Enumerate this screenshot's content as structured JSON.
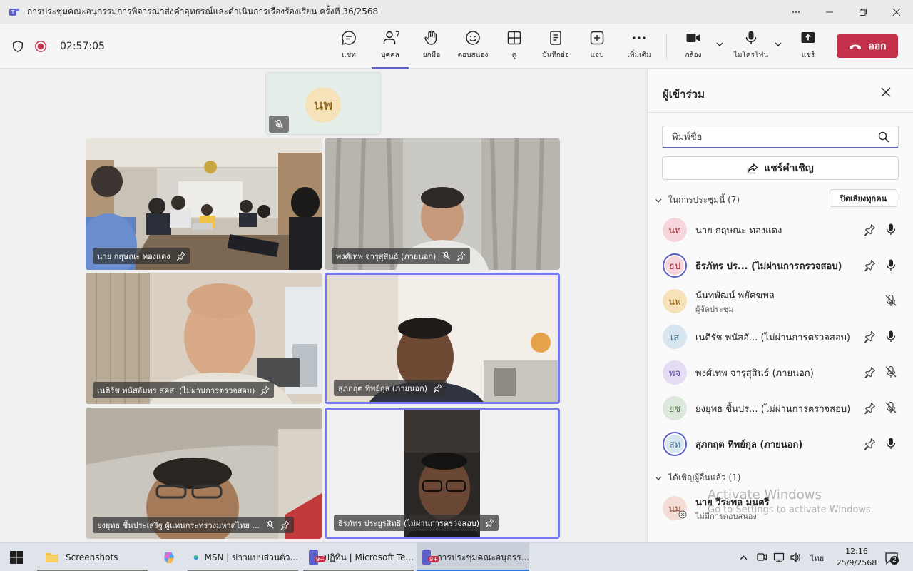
{
  "window": {
    "title": "การประชุมคณะอนุกรรมการพิจารณาส่งคำอุทธรณ์และดำเนินการเรื่องร้องเรียน ครั้งที่ 36/2568"
  },
  "toolbar": {
    "timer": "02:57:05",
    "chat": "แชท",
    "people": "บุคคล",
    "people_count": "7",
    "raise_hand": "ยกมือ",
    "react": "ตอบสนอง",
    "view": "ดู",
    "notes": "บันทึกย่อ",
    "apps": "แอป",
    "more": "เพิ่มเติม",
    "camera": "กล้อง",
    "mic": "ไมโครโฟน",
    "share": "แชร์",
    "leave": "ออก"
  },
  "stage": {
    "small_tile_initials": "นพ",
    "tiles": [
      {
        "name": "นาย กฤษณะ ทองแดง",
        "muted": false
      },
      {
        "name": "พงศ์เทพ จารุสุสินธ์ (ภายนอก)",
        "muted": true
      },
      {
        "name": "เนติรัช พนัสอัมพร สคส. (ไม่ผ่านการตรวจสอบ)",
        "muted": false
      },
      {
        "name": "สุภกฤต ทิพย์กุล (ภายนอก)",
        "muted": false
      },
      {
        "name": "ยงยุทธ ชื้นประเสริฐ ผู้แทนกระทรวงมหาดไทย ...",
        "muted": true
      },
      {
        "name": "ธีรภัทร ประยูรสิทธิ (ไม่ผ่านการตรวจสอบ)",
        "muted": false
      }
    ]
  },
  "panel": {
    "title": "ผู้เข้าร่วม",
    "search_placeholder": "พิมพ์ชื่อ",
    "share_invite": "แชร์คำเชิญ",
    "in_meeting": "ในการประชุมนี้ (7)",
    "mute_all": "ปิดเสียงทุกคน",
    "invited": "ได้เชิญผู้อื่นแล้ว (1)",
    "participants": [
      {
        "initials": "นท",
        "name": "นาย กฤษณะ ทองแดง",
        "role": "",
        "bold": false,
        "ring": false,
        "muted": false,
        "pin": true,
        "avbg": "#f6d5dc",
        "avfg": "#a4373a"
      },
      {
        "initials": "ธป",
        "name": "ธีรภัทร ปร... (ไม่ผ่านการตรวจสอบ)",
        "role": "",
        "bold": true,
        "ring": true,
        "muted": false,
        "pin": true,
        "avbg": "#f6d5dc",
        "avfg": "#a4373a"
      },
      {
        "initials": "นพ",
        "name": "นันทพัฒน์ พยัคฆพล",
        "role": "ผู้จัดประชุม",
        "bold": false,
        "ring": false,
        "muted": true,
        "pin": false,
        "avbg": "#f6e2b8",
        "avfg": "#8a5d0c"
      },
      {
        "initials": "เส",
        "name": "เนติรัช พนัสอั... (ไม่ผ่านการตรวจสอบ)",
        "role": "",
        "bold": false,
        "ring": false,
        "muted": false,
        "pin": true,
        "avbg": "#d7e6ee",
        "avfg": "#3b6e8a"
      },
      {
        "initials": "พจ",
        "name": "พงศ์เทพ จารุสุสินธ์ (ภายนอก)",
        "role": "",
        "bold": false,
        "ring": false,
        "muted": true,
        "pin": true,
        "avbg": "#e3dcf2",
        "avfg": "#5c4a9b"
      },
      {
        "initials": "ยช",
        "name": "ยงยุทธ ชื้นปร... (ไม่ผ่านการตรวจสอบ)",
        "role": "",
        "bold": false,
        "ring": false,
        "muted": true,
        "pin": true,
        "avbg": "#dde8dc",
        "avfg": "#4f7a47"
      },
      {
        "initials": "สท",
        "name": "สุภกฤต ทิพย์กุล (ภายนอก)",
        "role": "",
        "bold": true,
        "ring": true,
        "muted": false,
        "pin": true,
        "avbg": "#d7e6ee",
        "avfg": "#3b6e8a"
      }
    ],
    "invited_person": {
      "initials": "นม",
      "name": "นาย วีระพล มนตรี",
      "role": "ไม่มีการตอบสนอง"
    }
  },
  "watermark": {
    "line1": "Activate Windows",
    "line2": "Go to Settings to activate Windows."
  },
  "taskbar": {
    "screenshots": "Screenshots",
    "msn": "MSN | ข่าวแบบส่วนตัว...",
    "calendar": "ปฏิทิน | Microsoft Te...",
    "meeting": "การประชุมคณะอนุกรร...",
    "badge": "9+",
    "lang": "ไทย",
    "time": "12:16",
    "date": "25/9/2568",
    "notif": "2"
  }
}
